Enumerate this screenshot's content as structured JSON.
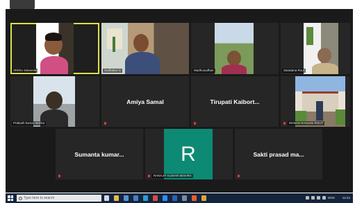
{
  "tiles": [
    {
      "name": "Shikha Saluwala",
      "type": "video"
    },
    {
      "name": "Sudhakar G",
      "type": "video"
    },
    {
      "name": "Madhusudhan",
      "type": "video"
    },
    {
      "name": "Sanatana Rout",
      "type": "video"
    },
    {
      "name": "Prakash kumar mishra",
      "type": "video"
    },
    {
      "name": "Amiya Samal",
      "type": "name"
    },
    {
      "name": "Tirupati Kaibort...",
      "type": "name"
    },
    {
      "name": "MANAS RANJAN ROUT",
      "type": "video"
    },
    {
      "name": "Sumanta kumar...",
      "type": "name"
    },
    {
      "name": "RANAJIT KUMAR MISHRA",
      "type": "avatar",
      "initial": "R",
      "avatar_color": "#0d8a74"
    },
    {
      "name": "Sakti prasad ma...",
      "type": "name"
    }
  ],
  "taskbar": {
    "search_placeholder": "Type here to search",
    "clock_time": "12:44",
    "clock_label": "ENG"
  },
  "colors": {
    "meeting_bg": "#1a1a1a",
    "tile_bg": "#262626",
    "active_speaker_border": "#d9e24a",
    "muted_mic": "#e53935",
    "taskbar_bg": "#13253d"
  }
}
